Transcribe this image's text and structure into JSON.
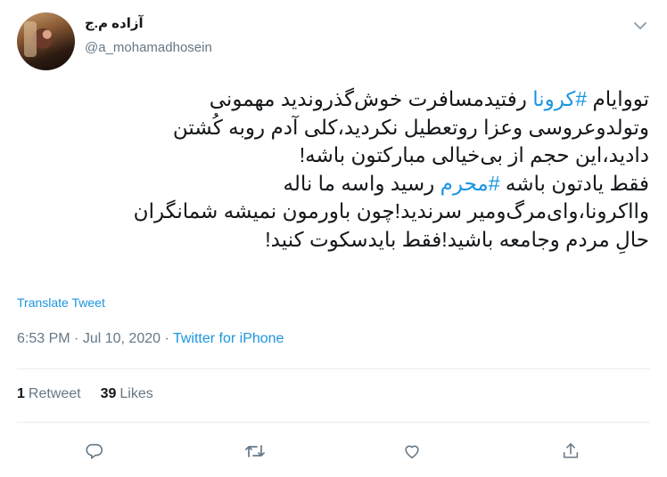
{
  "user": {
    "display_name": "آزاده م.ج",
    "handle": "@a_mohamadhosein"
  },
  "tweet": {
    "lines": [
      [
        "تووایام ",
        "#کرونا",
        " رفتیدمسافرت خوش‌گذروندید مهمونی"
      ],
      [
        "وتولدوعروسی وعزا روتعطیل نکردید،کلی آدم روبه کُشتن"
      ],
      [
        "دادید،این حجم از بی‌خیالی مبارکتون باشه!"
      ],
      [
        "فقط یادتون باشه ",
        "#محرم",
        " رسید واسه ما ناله"
      ],
      [
        "وااکرونا،وای‌مرگ‌ومیر سرندید!چون باورمون نمیشه شمانگران"
      ],
      [
        "حالِ مردم وجامعه باشید!فقط بایدسکوت کنید!"
      ]
    ],
    "translate_label": "Translate Tweet",
    "time": "6:53 PM",
    "date": "Jul 10, 2020",
    "separator": "·",
    "source": "Twitter for iPhone"
  },
  "stats": {
    "retweets_count": "1",
    "retweets_label": "Retweet",
    "likes_count": "39",
    "likes_label": "Likes"
  },
  "icons": {
    "caret": "chevron-down-icon",
    "reply": "reply-icon",
    "retweet": "retweet-icon",
    "like": "heart-icon",
    "share": "share-icon"
  },
  "colors": {
    "link": "#1b95e0",
    "muted": "#657786",
    "text": "#14171a"
  }
}
